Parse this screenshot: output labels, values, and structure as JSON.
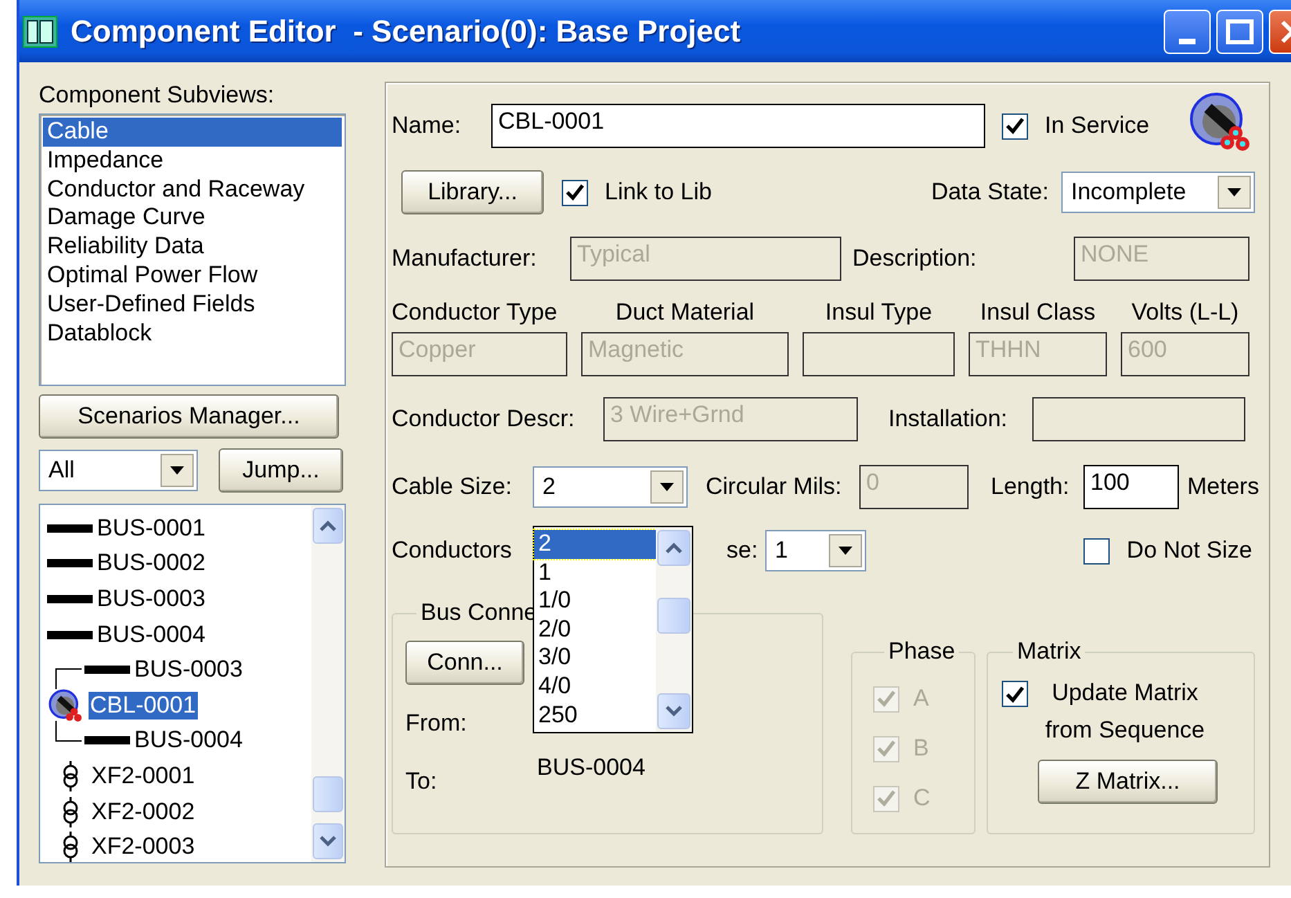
{
  "window": {
    "title": "Component Editor  - Scenario(0): Base Project"
  },
  "subviews": {
    "label": "Component Subviews:",
    "items": [
      {
        "label": "Cable",
        "selected": true
      },
      {
        "label": "Impedance",
        "selected": false
      },
      {
        "label": "Conductor and Raceway",
        "selected": false
      },
      {
        "label": "Damage Curve",
        "selected": false
      },
      {
        "label": "Reliability Data",
        "selected": false
      },
      {
        "label": "Optimal Power Flow",
        "selected": false
      },
      {
        "label": "User-Defined Fields",
        "selected": false
      },
      {
        "label": "Datablock",
        "selected": false
      }
    ]
  },
  "scenarios_button": "Scenarios Manager...",
  "filter": {
    "value": "All"
  },
  "jump_button": "Jump...",
  "tree": {
    "items": [
      {
        "label": "BUS-0001",
        "kind": "bus",
        "selected": false
      },
      {
        "label": "BUS-0002",
        "kind": "bus",
        "selected": false
      },
      {
        "label": "BUS-0003",
        "kind": "bus",
        "selected": false
      },
      {
        "label": "BUS-0004",
        "kind": "bus",
        "selected": false
      },
      {
        "label": "CBL-0001",
        "kind": "cable",
        "selected": true,
        "from": {
          "label": "BUS-0003",
          "kind": "bus"
        },
        "to": {
          "label": "BUS-0004",
          "kind": "bus"
        }
      },
      {
        "label": "XF2-0001",
        "kind": "transformer",
        "selected": false
      },
      {
        "label": "XF2-0002",
        "kind": "transformer",
        "selected": false
      },
      {
        "label": "XF2-0003",
        "kind": "transformer",
        "selected": false
      }
    ]
  },
  "form": {
    "name": {
      "label": "Name:",
      "value": "CBL-0001"
    },
    "in_service": {
      "label": "In Service",
      "checked": true
    },
    "library_button": "Library...",
    "link_to_lib": {
      "label": "Link to Lib",
      "checked": true
    },
    "data_state": {
      "label": "Data State:",
      "value": "Incomplete"
    },
    "manufacturer": {
      "label": "Manufacturer:",
      "value": "Typical",
      "disabled": true
    },
    "description": {
      "label": "Description:",
      "value": "NONE",
      "disabled": true
    },
    "conductor_columns": [
      {
        "label": "Conductor Type",
        "value": "Copper",
        "disabled": true
      },
      {
        "label": "Duct Material",
        "value": "Magnetic",
        "disabled": true
      },
      {
        "label": "Insul Type",
        "disabled": true
      },
      {
        "label": "Insul Class",
        "value": "THHN",
        "disabled": true
      },
      {
        "label": "Volts (L-L)",
        "value": "600",
        "disabled": true
      }
    ],
    "conductor_descr": {
      "label": "Conductor Descr:",
      "value": "3 Wire+Grnd",
      "disabled": true
    },
    "installation": {
      "label": "Installation:",
      "disabled": true
    },
    "cable_size": {
      "label": "Cable Size:",
      "value": "2",
      "expanded": true,
      "options": [
        {
          "label": "2",
          "selected": true
        },
        {
          "label": "1",
          "selected": false
        },
        {
          "label": "1/0",
          "selected": false
        },
        {
          "label": "2/0",
          "selected": false
        },
        {
          "label": "3/0",
          "selected": false
        },
        {
          "label": "4/0",
          "selected": false
        },
        {
          "label": "250",
          "selected": false
        }
      ]
    },
    "circular_mils": {
      "label": "Circular Mils:",
      "value": "0",
      "disabled": true
    },
    "length": {
      "label": "Length:",
      "value": "100",
      "unit": "Meters"
    },
    "conductors_per_phase": {
      "label_start": "Conductors",
      "label_end": "se:",
      "value": "1"
    },
    "do_not_size": {
      "label": "Do Not Size",
      "checked": false
    },
    "bus_connection": {
      "label": "Bus Conne",
      "conn_button": "Conn...",
      "from_label": "From:",
      "to_label": "To:",
      "to_value": "BUS-0004"
    },
    "phase": {
      "label": "Phase",
      "items": [
        {
          "label": "A",
          "checked": true,
          "disabled": true
        },
        {
          "label": "B",
          "checked": true,
          "disabled": true
        },
        {
          "label": "C",
          "checked": true,
          "disabled": true
        }
      ]
    },
    "matrix": {
      "label": "Matrix",
      "update": {
        "label": "Update Matrix from Sequence",
        "checked": true
      },
      "z_button": "Z Matrix..."
    }
  }
}
